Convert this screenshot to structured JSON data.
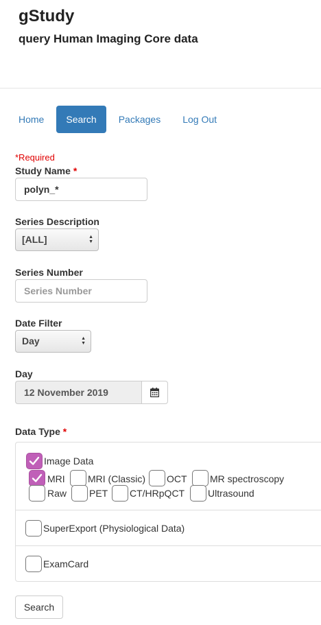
{
  "app": {
    "title": "gStudy",
    "subtitle": "query Human Imaging Core data"
  },
  "nav": {
    "items": [
      "Home",
      "Search",
      "Packages",
      "Log Out"
    ],
    "active": "Search",
    "accent_color": "#337ab7"
  },
  "form": {
    "required_note": "*Required",
    "study_name": {
      "label": "Study Name",
      "required_mark": "*",
      "value": "polyn_*"
    },
    "series_description": {
      "label": "Series Description",
      "selected": "[ALL]"
    },
    "series_number": {
      "label": "Series Number",
      "placeholder": "Series Number",
      "value": ""
    },
    "date_filter": {
      "label": "Date Filter",
      "selected": "Day"
    },
    "day": {
      "label": "Day",
      "value": "12 November 2019",
      "button_icon": "calendar-icon"
    },
    "data_type": {
      "label": "Data Type",
      "required_mark": "*",
      "checked_color": "#c05fb8",
      "image_data": {
        "label": "Image Data",
        "checked": true,
        "options": [
          {
            "label": "MRI",
            "checked": true
          },
          {
            "label": "MRI (Classic)",
            "checked": false
          },
          {
            "label": "OCT",
            "checked": false
          },
          {
            "label": "MR spectroscopy",
            "checked": false
          },
          {
            "label": "Raw",
            "checked": false
          },
          {
            "label": "PET",
            "checked": false
          },
          {
            "label": "CT/HRpQCT",
            "checked": false
          },
          {
            "label": "Ultrasound",
            "checked": false
          }
        ]
      },
      "super_export": {
        "label": "SuperExport (Physiological Data)",
        "checked": false
      },
      "exam_card": {
        "label": "ExamCard",
        "checked": false
      }
    },
    "search_button": "Search"
  }
}
